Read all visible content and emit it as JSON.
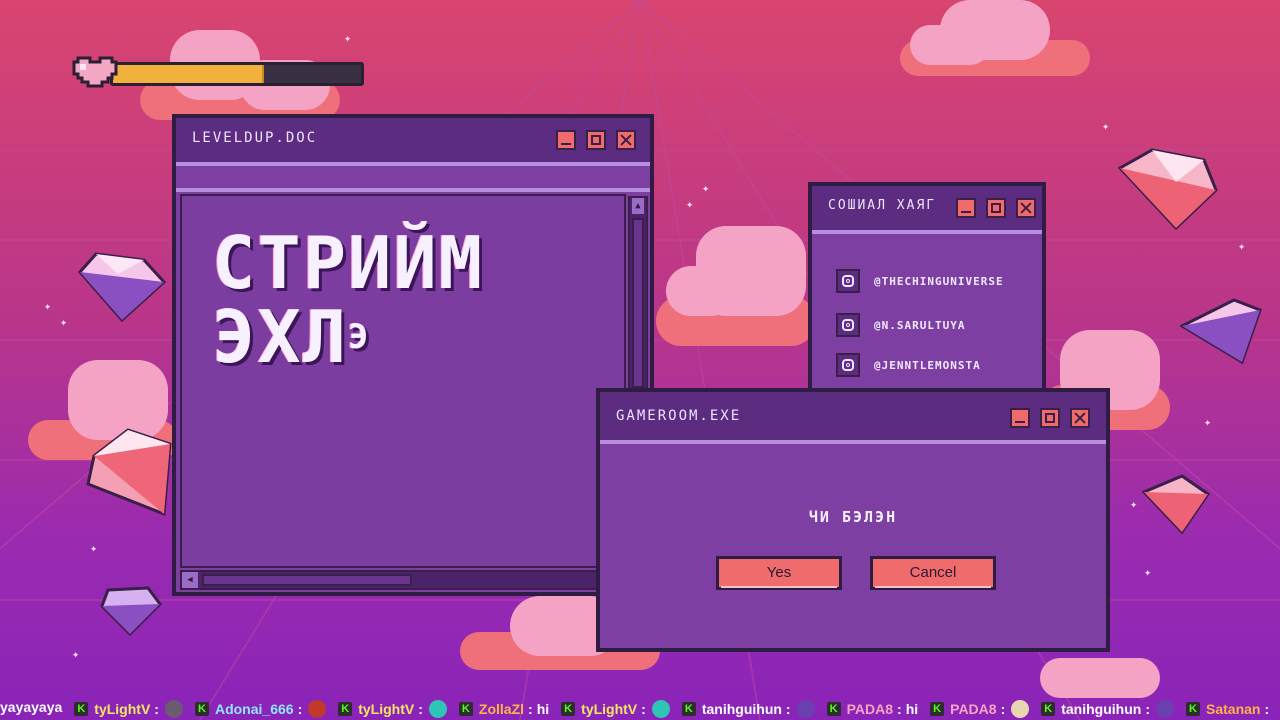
{
  "health": {
    "value": 0.6
  },
  "windows": {
    "doc": {
      "title": "LEVELDUP.DOC",
      "heading_line1": "СТРИЙМ",
      "heading_line2": "ЭХЛ",
      "heading_sup": "Э"
    },
    "social": {
      "title": "СОШИАЛ ХАЯГ",
      "items": [
        {
          "icon": "instagram-icon",
          "handle": "@THECHINGUNIVERSE"
        },
        {
          "icon": "instagram-icon",
          "handle": "@N.SARULTUYA"
        },
        {
          "icon": "instagram-icon",
          "handle": "@JENNTLEMONSTA"
        }
      ]
    },
    "dialog": {
      "title": "GAMEROOM.EXE",
      "message": "ЧИ БЭЛЭН",
      "yes_label": "Yes",
      "cancel_label": "Cancel"
    }
  },
  "chat": [
    {
      "user": "",
      "message": "yayayaya",
      "color": "#ffffff",
      "badge": false
    },
    {
      "user": "tyLightV",
      "message": "",
      "color": "#f5e663",
      "badge": true,
      "emote": "#6b5b6e"
    },
    {
      "user": "Adonai_666",
      "message": "",
      "color": "#8ee8ff",
      "badge": true,
      "emote": "#c0392b"
    },
    {
      "user": "tyLightV",
      "message": "",
      "color": "#f5e663",
      "badge": true,
      "emote": "#2ec4b6"
    },
    {
      "user": "ZollaZl",
      "message": "hi",
      "color": "#ffb347",
      "badge": true
    },
    {
      "user": "tyLightV",
      "message": "",
      "color": "#f5e663",
      "badge": true,
      "emote": "#2ec4b6"
    },
    {
      "user": "tanihguihun",
      "message": "",
      "color": "#ffffff",
      "badge": true,
      "emote": "#6a3fb0"
    },
    {
      "user": "PADA8",
      "message": "hi",
      "color": "#f8a1c0",
      "badge": true
    },
    {
      "user": "PADA8",
      "message": "",
      "color": "#f8a1c0",
      "badge": true,
      "emote": "#e8d6b0"
    },
    {
      "user": "tanihguihun",
      "message": "",
      "color": "#ffffff",
      "badge": true,
      "emote": "#6a3fb0"
    },
    {
      "user": "Satanan",
      "message": "",
      "color": "#ffb347",
      "badge": true
    }
  ],
  "colors": {
    "bg_top": "#d9456f",
    "bg_bottom": "#8a24b8",
    "window": "#7d3fa2",
    "titlebar": "#5b2c80",
    "button": "#f06b6b",
    "health_fill": "#f2b03d"
  }
}
